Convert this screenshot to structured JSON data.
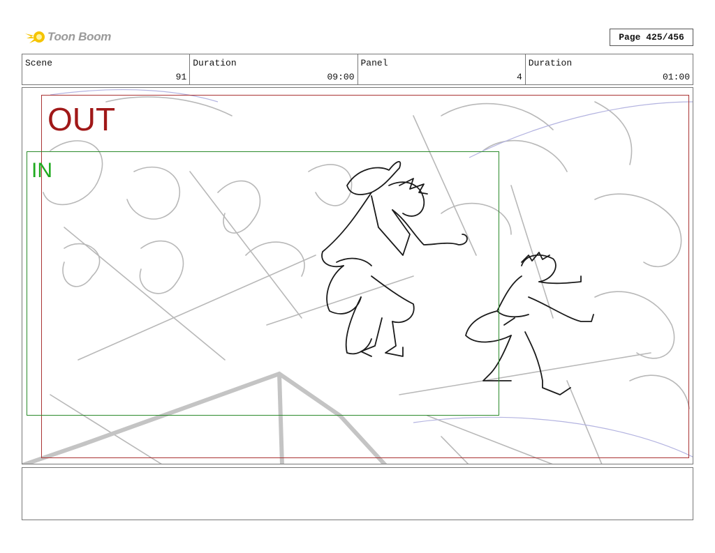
{
  "header": {
    "logo_text": "Toon Boom",
    "page_label": "Page 425/456"
  },
  "info": {
    "scene_label": "Scene",
    "scene_value": "91",
    "scene_duration_label": "Duration",
    "scene_duration_value": "09:00",
    "panel_label": "Panel",
    "panel_value": "4",
    "panel_duration_label": "Duration",
    "panel_duration_value": "01:00"
  },
  "frames": {
    "out_label": "OUT",
    "in_label": "IN"
  },
  "notes": {
    "text": ""
  },
  "colors": {
    "out_frame": "#a33333",
    "in_frame": "#2a8a2a",
    "logo_accent": "#f5c400"
  }
}
